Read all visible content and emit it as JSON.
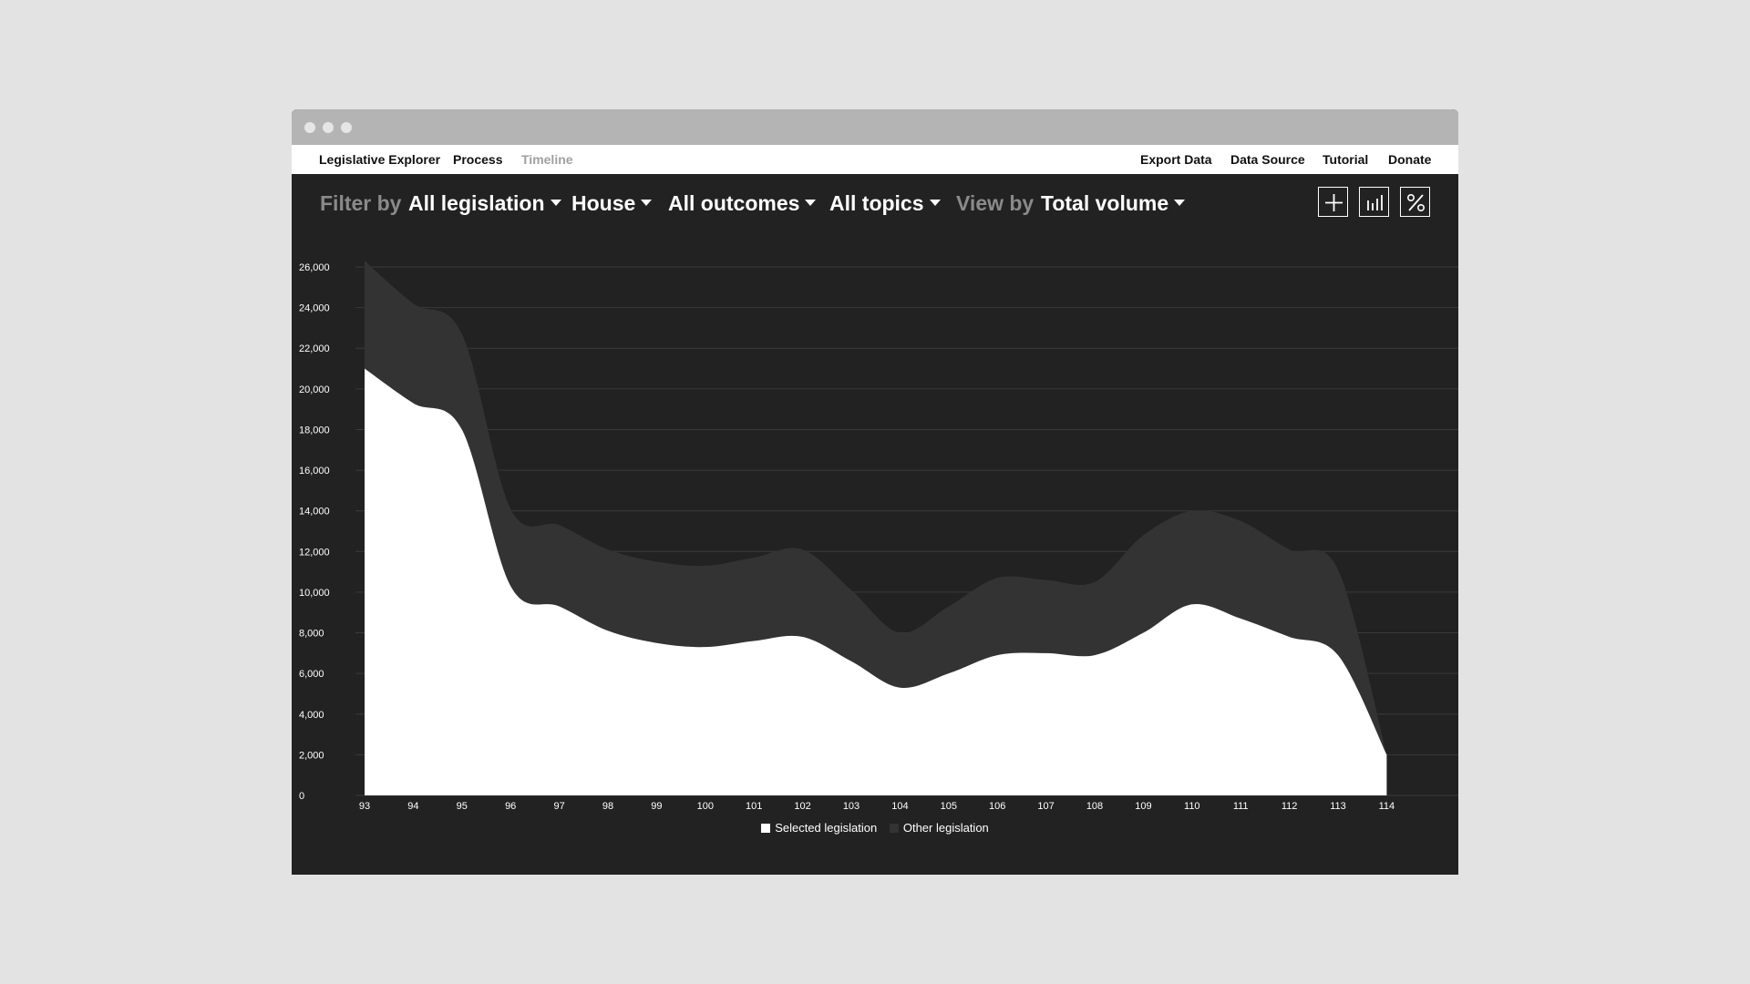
{
  "nav": {
    "left": [
      {
        "label": "Legislative Explorer",
        "active": true
      },
      {
        "label": "Process",
        "active": true
      },
      {
        "label": "Timeline",
        "active": false
      }
    ],
    "right": [
      {
        "label": "Export Data"
      },
      {
        "label": "Data Source"
      },
      {
        "label": "Tutorial"
      },
      {
        "label": "Donate"
      }
    ]
  },
  "filters": {
    "filter_by_label": "Filter by",
    "legislation": "All legislation",
    "chamber": "House",
    "outcomes": "All outcomes",
    "topics": "All topics",
    "view_by_label": "View by",
    "view": "Total volume"
  },
  "tools": [
    {
      "icon": "plus-icon"
    },
    {
      "icon": "bar-chart-icon"
    },
    {
      "icon": "percent-icon"
    }
  ],
  "colors": {
    "background": "#222222",
    "selected": "#ffffff",
    "other": "#333333",
    "grid": "#3a3a3a"
  },
  "chart_data": {
    "type": "area",
    "stacked": true,
    "x": [
      "93",
      "94",
      "95",
      "96",
      "97",
      "98",
      "99",
      "100",
      "101",
      "102",
      "103",
      "104",
      "105",
      "106",
      "107",
      "108",
      "109",
      "110",
      "111",
      "112",
      "113",
      "114"
    ],
    "series": [
      {
        "name": "Selected legislation",
        "values": [
          21000,
          19300,
          18000,
          10300,
          9300,
          8100,
          7500,
          7300,
          7600,
          7800,
          6600,
          5300,
          6000,
          6900,
          7000,
          6900,
          8000,
          9400,
          8700,
          7800,
          6900,
          2000
        ]
      },
      {
        "name": "Other legislation",
        "values": [
          5300,
          4900,
          4700,
          3800,
          4000,
          4000,
          4000,
          4000,
          4100,
          4300,
          3500,
          2700,
          3300,
          3800,
          3600,
          3600,
          4800,
          4600,
          4800,
          4300,
          4200,
          0
        ]
      }
    ],
    "ylim": [
      0,
      26000
    ],
    "yticks": [
      0,
      2000,
      4000,
      6000,
      8000,
      10000,
      12000,
      14000,
      16000,
      18000,
      20000,
      22000,
      24000,
      26000
    ],
    "ytick_labels": [
      "0",
      "2,000",
      "4,000",
      "6,000",
      "8,000",
      "10,000",
      "12,000",
      "14,000",
      "16,000",
      "18,000",
      "20,000",
      "22,000",
      "24,000",
      "26,000"
    ],
    "grid": true,
    "legend_position": "bottom-center"
  }
}
